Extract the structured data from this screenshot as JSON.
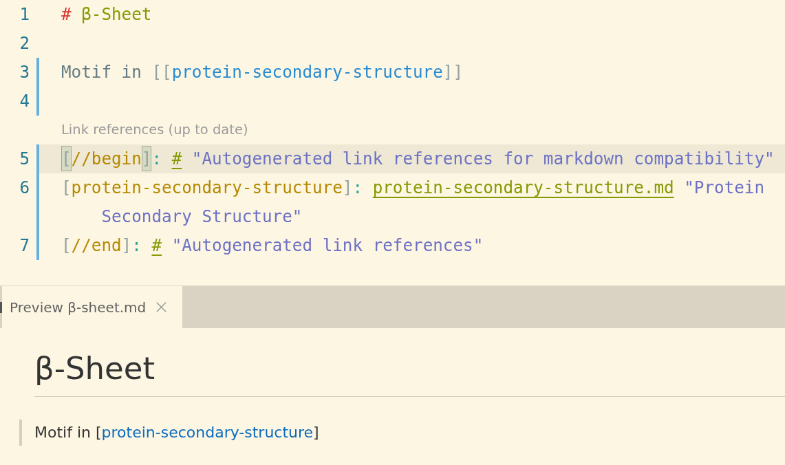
{
  "editor": {
    "rows": [
      {
        "kind": "line",
        "number": "1",
        "changed": false,
        "current": false,
        "groups": [
          [
            {
              "kind": "heading-mark",
              "text": "#",
              "matched": false
            }
          ],
          [
            {
              "kind": "heading",
              "text": "β-Sheet",
              "matched": false
            }
          ]
        ]
      },
      {
        "kind": "line",
        "number": "2",
        "changed": false,
        "current": false
      },
      {
        "kind": "line",
        "number": "3",
        "changed": true,
        "current": false,
        "groups": [
          [
            {
              "kind": "plain",
              "text": "Motif in",
              "matched": false
            }
          ],
          [
            {
              "kind": "bracket",
              "text": "[[",
              "matched": false
            },
            {
              "kind": "wiki-link",
              "text": "protein-secondary-structure",
              "matched": false
            },
            {
              "kind": "bracket",
              "text": "]]",
              "matched": false
            }
          ]
        ]
      },
      {
        "kind": "line",
        "number": "4",
        "changed": true,
        "current": false
      },
      {
        "kind": "codelens",
        "text": "Link references (up to date)"
      },
      {
        "kind": "line",
        "number": "5",
        "changed": true,
        "current": true,
        "groups": [
          [
            {
              "kind": "bracket",
              "text": "[",
              "matched": true
            },
            {
              "kind": "ref-label",
              "text": "//begin",
              "matched": false
            },
            {
              "kind": "bracket",
              "text": "]",
              "matched": true
            },
            {
              "kind": "colon",
              "text": ":",
              "matched": false
            }
          ],
          [
            {
              "kind": "hash",
              "text": "#",
              "matched": false
            }
          ],
          [
            {
              "kind": "string",
              "text": "\"Autogenerated link references for markdown compatibility\"",
              "matched": false
            }
          ]
        ]
      },
      {
        "kind": "line",
        "number": "6",
        "changed": true,
        "current": false,
        "groups": [
          [
            {
              "kind": "bracket",
              "text": "[",
              "matched": false
            },
            {
              "kind": "ref-label",
              "text": "protein-secondary-structure",
              "matched": false
            },
            {
              "kind": "bracket",
              "text": "]",
              "matched": false
            },
            {
              "kind": "colon",
              "text": ":",
              "matched": false
            }
          ],
          [
            {
              "kind": "url",
              "text": "protein-secondary-structure.md",
              "matched": false
            }
          ],
          [
            {
              "kind": "string",
              "text": "\"Protein",
              "matched": false
            }
          ]
        ],
        "wrapped_groups": [
          [
            {
              "kind": "string",
              "text": "Secondary Structure\"",
              "matched": false
            }
          ]
        ]
      },
      {
        "kind": "line",
        "number": "7",
        "changed": true,
        "current": false,
        "groups": [
          [
            {
              "kind": "bracket",
              "text": "[",
              "matched": false
            },
            {
              "kind": "ref-label",
              "text": "//end",
              "matched": false
            },
            {
              "kind": "bracket",
              "text": "]",
              "matched": false
            },
            {
              "kind": "colon",
              "text": ":",
              "matched": false
            }
          ],
          [
            {
              "kind": "hash",
              "text": "#",
              "matched": false
            }
          ],
          [
            {
              "kind": "string",
              "text": "\"Autogenerated link references\"",
              "matched": false
            }
          ]
        ]
      }
    ]
  },
  "panel": {
    "tabs": [
      {
        "label": "Preview β-sheet.md",
        "selected": true
      }
    ]
  },
  "preview": {
    "heading": "β-Sheet",
    "blockquote": {
      "before": "Motif in [",
      "link": "protein-secondary-structure",
      "after": "]"
    }
  }
}
